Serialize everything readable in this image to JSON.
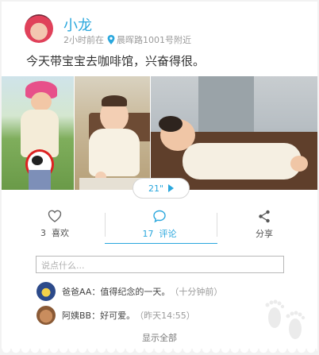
{
  "post": {
    "username": "小龙",
    "time": "2小时前在",
    "location": "晨晖路1001号附近",
    "text": "今天带宝宝去咖啡馆，兴奋得很。"
  },
  "media": {
    "duration": "21\""
  },
  "actions": {
    "like_count": "3",
    "like_label": "喜欢",
    "comment_count": "17",
    "comment_label": "评论",
    "share_label": "分享"
  },
  "comment_input": {
    "placeholder": "说点什么..."
  },
  "comments": [
    {
      "author": "爸爸AA",
      "separator": "：",
      "text": "值得纪念的一天。",
      "time": "（十分钟前）"
    },
    {
      "author": "阿姨BB",
      "separator": " ：",
      "text": "好可爱。",
      "time": "（昨天14:55）"
    }
  ],
  "show_all_label": "显示全部",
  "colors": {
    "accent": "#2aa7dd",
    "muted": "#9a9a9a"
  }
}
